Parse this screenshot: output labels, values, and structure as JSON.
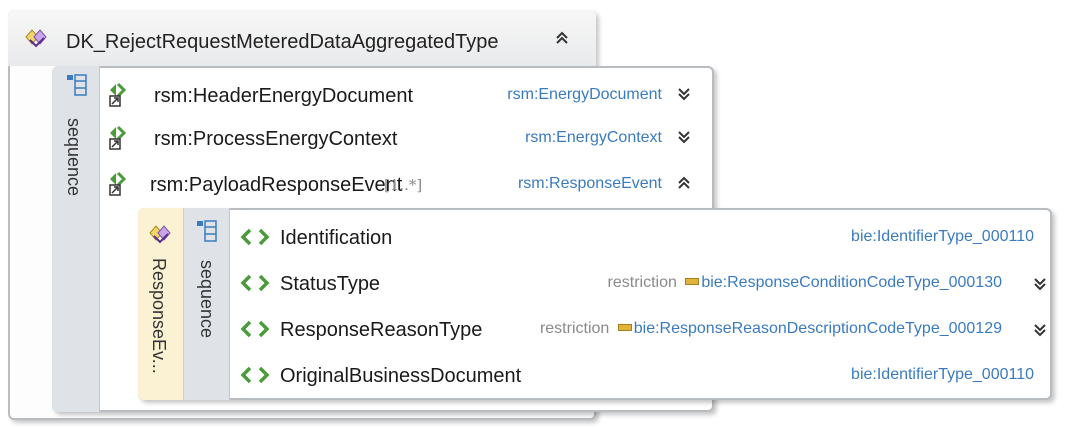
{
  "root": {
    "title": "DK_RejectRequestMeteredDataAggregatedType",
    "compositor_label": "sequence"
  },
  "elements": [
    {
      "name": "rsm:HeaderEnergyDocument",
      "cardinality": "",
      "type": "rsm:EnergyDocument",
      "expanded": false
    },
    {
      "name": "rsm:ProcessEnergyContext",
      "cardinality": "",
      "type": "rsm:EnergyContext",
      "expanded": false
    },
    {
      "name": "rsm:PayloadResponseEvent",
      "cardinality": "[1..*]",
      "type": "rsm:ResponseEvent",
      "expanded": true
    }
  ],
  "response_event": {
    "label": "ResponseEv...",
    "compositor_label": "sequence",
    "children": [
      {
        "name": "Identification",
        "restriction": "",
        "type": "bie:IdentifierType_000110",
        "expandable": false
      },
      {
        "name": "StatusType",
        "restriction": "restriction",
        "type": "bie:ResponseConditionCodeType_000130",
        "expandable": true
      },
      {
        "name": "ResponseReasonType",
        "restriction": "restriction",
        "type": "bie:ResponseReasonDescriptionCodeType_000129",
        "expandable": true
      },
      {
        "name": "OriginalBusinessDocument",
        "restriction": "",
        "type": "bie:IdentifierType_000110",
        "expandable": false
      }
    ]
  },
  "colors": {
    "type_link": "#3a7bbf",
    "sequence_bar": "#dfe3e8",
    "complex_type_bar": "#fbf2d3",
    "border": "#b9bcc0"
  },
  "icons": {
    "complex_type": "complex-type-icon",
    "sequence": "sequence-icon",
    "element_reference": "element-reference-icon",
    "element": "element-icon",
    "expand": "chevron-double-down-icon",
    "collapse": "chevron-double-up-icon",
    "restriction": "restriction-icon"
  }
}
